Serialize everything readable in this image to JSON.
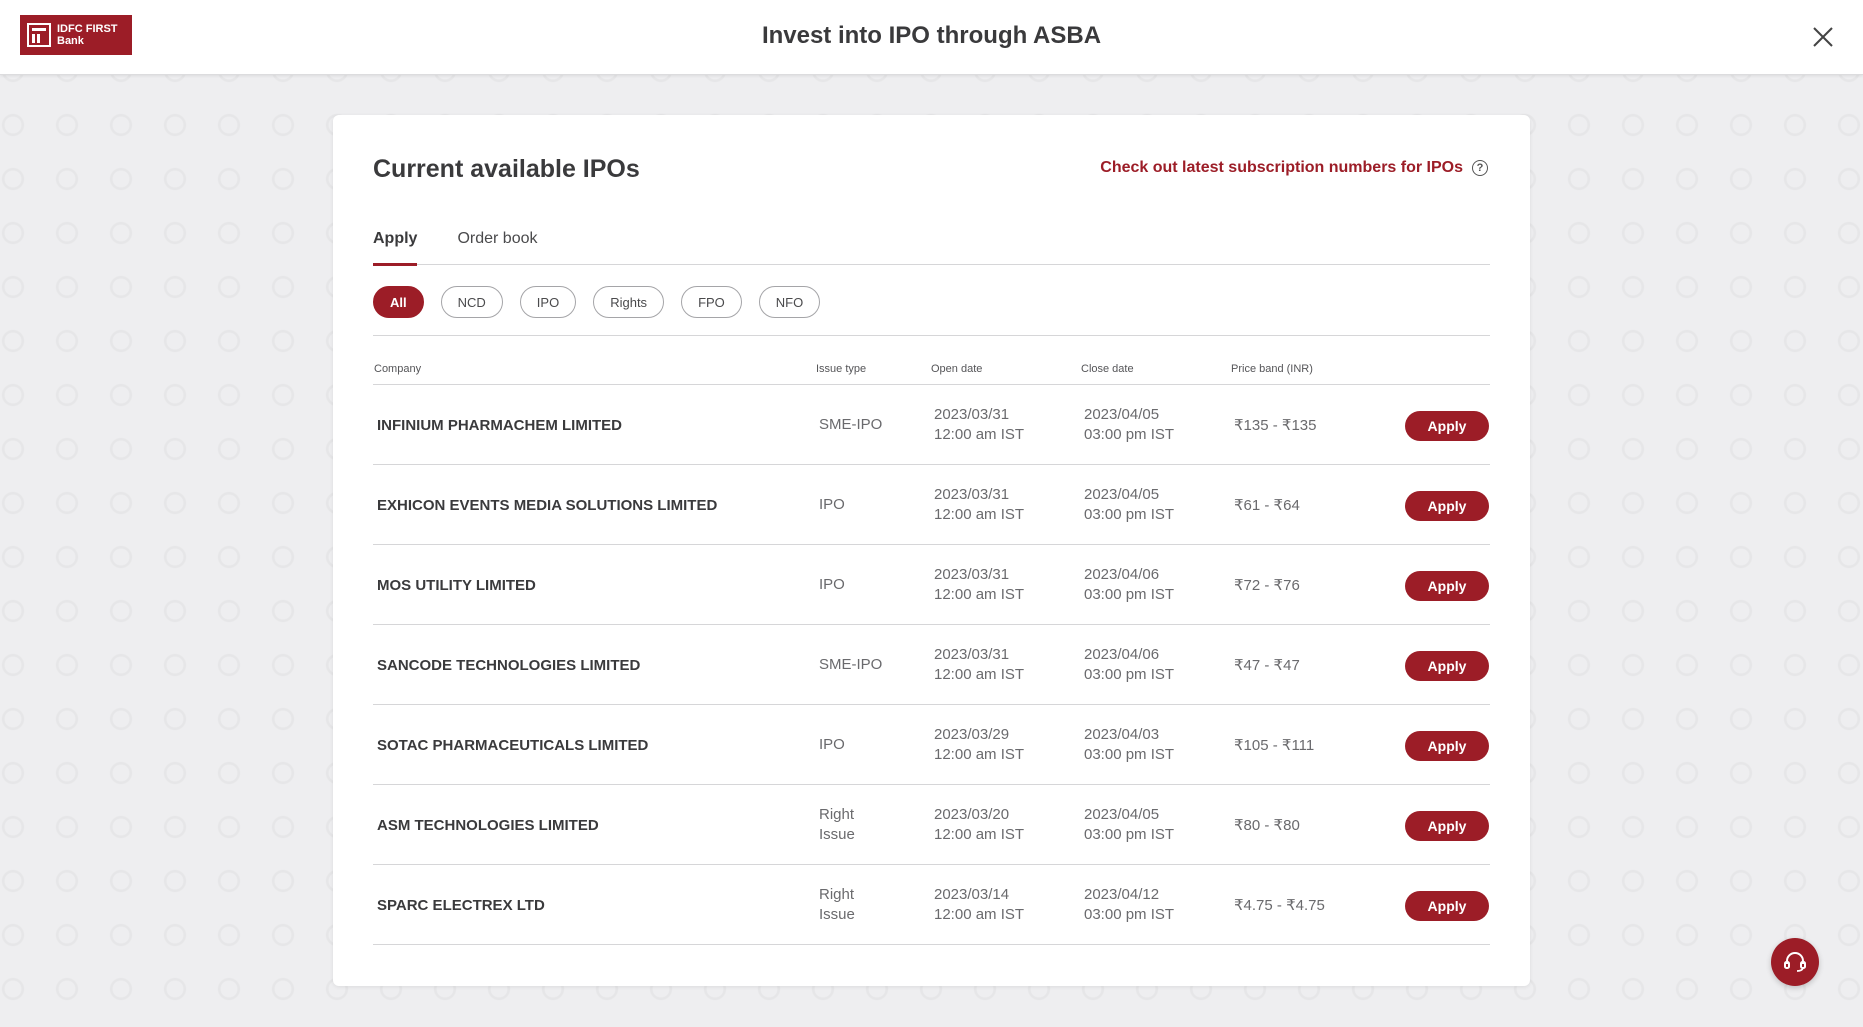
{
  "header": {
    "logo_line1": "IDFC FIRST",
    "logo_line2": "Bank",
    "title": "Invest into IPO through ASBA"
  },
  "card": {
    "title": "Current available IPOs",
    "subscription_link": "Check out latest subscription numbers for IPOs"
  },
  "tabs": [
    {
      "label": "Apply",
      "active": true
    },
    {
      "label": "Order book",
      "active": false
    }
  ],
  "filters": [
    {
      "label": "All",
      "active": true
    },
    {
      "label": "NCD",
      "active": false
    },
    {
      "label": "IPO",
      "active": false
    },
    {
      "label": "Rights",
      "active": false
    },
    {
      "label": "FPO",
      "active": false
    },
    {
      "label": "NFO",
      "active": false
    }
  ],
  "table": {
    "columns": [
      "Company",
      "Issue type",
      "Open date",
      "Close date",
      "Price band (INR)"
    ],
    "apply_label": "Apply",
    "rows": [
      {
        "company": "INFINIUM PHARMACHEM LIMITED",
        "type1": "SME-IPO",
        "type2": "",
        "open_date": "2023/03/31",
        "open_time": "12:00 am IST",
        "close_date": "2023/04/05",
        "close_time": "03:00 pm IST",
        "price": "₹135 - ₹135"
      },
      {
        "company": "EXHICON EVENTS MEDIA SOLUTIONS LIMITED",
        "type1": "IPO",
        "type2": "",
        "open_date": "2023/03/31",
        "open_time": "12:00 am IST",
        "close_date": "2023/04/05",
        "close_time": "03:00 pm IST",
        "price": "₹61 - ₹64"
      },
      {
        "company": "MOS UTILITY LIMITED",
        "type1": "IPO",
        "type2": "",
        "open_date": "2023/03/31",
        "open_time": "12:00 am IST",
        "close_date": "2023/04/06",
        "close_time": "03:00 pm IST",
        "price": "₹72 - ₹76"
      },
      {
        "company": "SANCODE TECHNOLOGIES LIMITED",
        "type1": "SME-IPO",
        "type2": "",
        "open_date": "2023/03/31",
        "open_time": "12:00 am IST",
        "close_date": "2023/04/06",
        "close_time": "03:00 pm IST",
        "price": "₹47 - ₹47"
      },
      {
        "company": "SOTAC PHARMACEUTICALS LIMITED",
        "type1": "IPO",
        "type2": "",
        "open_date": "2023/03/29",
        "open_time": "12:00 am IST",
        "close_date": "2023/04/03",
        "close_time": "03:00 pm IST",
        "price": "₹105 - ₹111"
      },
      {
        "company": "ASM TECHNOLOGIES LIMITED",
        "type1": "Right",
        "type2": "Issue",
        "open_date": "2023/03/20",
        "open_time": "12:00 am IST",
        "close_date": "2023/04/05",
        "close_time": "03:00 pm IST",
        "price": "₹80 - ₹80"
      },
      {
        "company": "SPARC ELECTREX LTD",
        "type1": "Right",
        "type2": "Issue",
        "open_date": "2023/03/14",
        "open_time": "12:00 am IST",
        "close_date": "2023/04/12",
        "close_time": "03:00 pm IST",
        "price": "₹4.75 - ₹4.75"
      }
    ]
  },
  "icons": {
    "close": "close-icon",
    "help": "help-circle-icon",
    "support": "headset-icon"
  },
  "colors": {
    "brand": "#9c1d27",
    "background": "#eeeef0",
    "card": "#ffffff"
  }
}
